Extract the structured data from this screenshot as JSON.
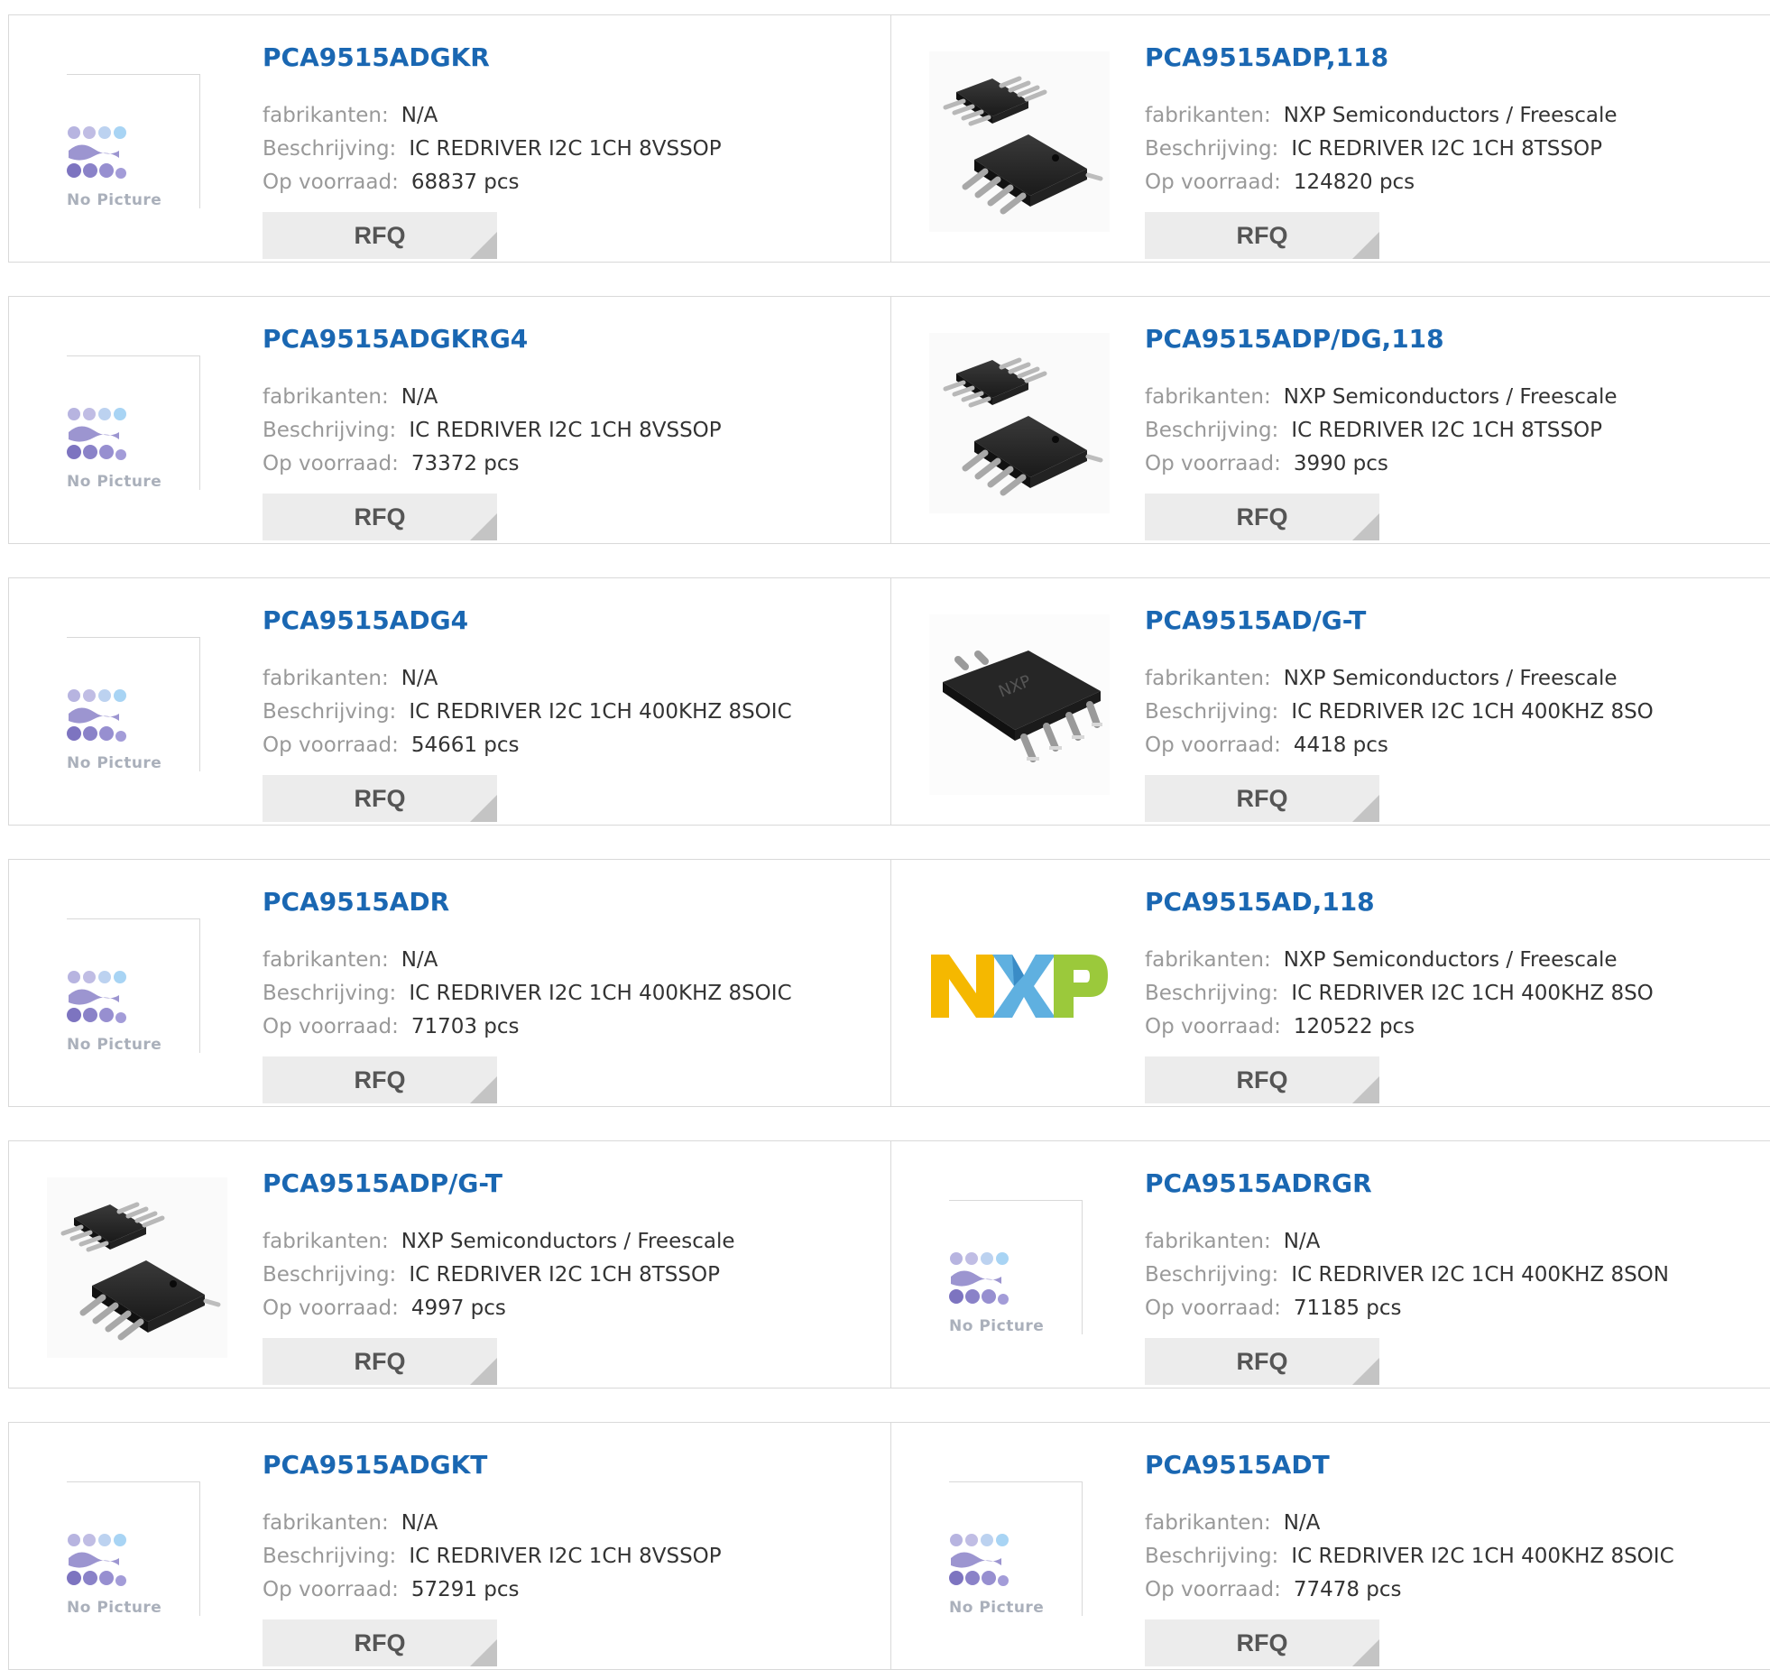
{
  "labels": {
    "manufacturer": "fabrikanten:",
    "description": "Beschrijving:",
    "stock": "Op voorraad:",
    "rfq": "RFQ",
    "no_picture": "No Picture"
  },
  "colors": {
    "part_number": "#1a67b2",
    "label": "#999999",
    "value": "#333333",
    "rfq_bg": "#ececec",
    "border": "#d9d9d9"
  },
  "products": [
    {
      "part": "PCA9515ADGKR",
      "manufacturer": "N/A",
      "description": "IC REDRIVER I2C 1CH 8VSSOP",
      "stock": "68837 pcs",
      "image": "no-picture"
    },
    {
      "part": "PCA9515ADP,118",
      "manufacturer": "NXP Semiconductors / Freescale",
      "description": "IC REDRIVER I2C 1CH 8TSSOP",
      "stock": "124820 pcs",
      "image": "tssop-chip"
    },
    {
      "part": "PCA9515ADGKRG4",
      "manufacturer": "N/A",
      "description": "IC REDRIVER I2C 1CH 8VSSOP",
      "stock": "73372 pcs",
      "image": "no-picture"
    },
    {
      "part": "PCA9515ADP/DG,118",
      "manufacturer": "NXP Semiconductors / Freescale",
      "description": "IC REDRIVER I2C 1CH 8TSSOP",
      "stock": "3990 pcs",
      "image": "tssop-chip"
    },
    {
      "part": "PCA9515ADG4",
      "manufacturer": "N/A",
      "description": "IC REDRIVER I2C 1CH 400KHZ 8SOIC",
      "stock": "54661 pcs",
      "image": "no-picture"
    },
    {
      "part": "PCA9515AD/G-T",
      "manufacturer": "NXP Semiconductors / Freescale",
      "description": "IC REDRIVER I2C 1CH 400KHZ 8SO",
      "stock": "4418 pcs",
      "image": "so8-chip"
    },
    {
      "part": "PCA9515ADR",
      "manufacturer": "N/A",
      "description": "IC REDRIVER I2C 1CH 400KHZ 8SOIC",
      "stock": "71703 pcs",
      "image": "no-picture"
    },
    {
      "part": "PCA9515AD,118",
      "manufacturer": "NXP Semiconductors / Freescale",
      "description": "IC REDRIVER I2C 1CH 400KHZ 8SO",
      "stock": "120522 pcs",
      "image": "nxp-logo"
    },
    {
      "part": "PCA9515ADP/G-T",
      "manufacturer": "NXP Semiconductors / Freescale",
      "description": "IC REDRIVER I2C 1CH 8TSSOP",
      "stock": "4997 pcs",
      "image": "tssop-chip"
    },
    {
      "part": "PCA9515ADRGR",
      "manufacturer": "N/A",
      "description": "IC REDRIVER I2C 1CH 400KHZ 8SON",
      "stock": "71185 pcs",
      "image": "no-picture"
    },
    {
      "part": "PCA9515ADGKT",
      "manufacturer": "N/A",
      "description": "IC REDRIVER I2C 1CH 8VSSOP",
      "stock": "57291 pcs",
      "image": "no-picture"
    },
    {
      "part": "PCA9515ADT",
      "manufacturer": "N/A",
      "description": "IC REDRIVER I2C 1CH 400KHZ 8SOIC",
      "stock": "77478 pcs",
      "image": "no-picture"
    }
  ]
}
